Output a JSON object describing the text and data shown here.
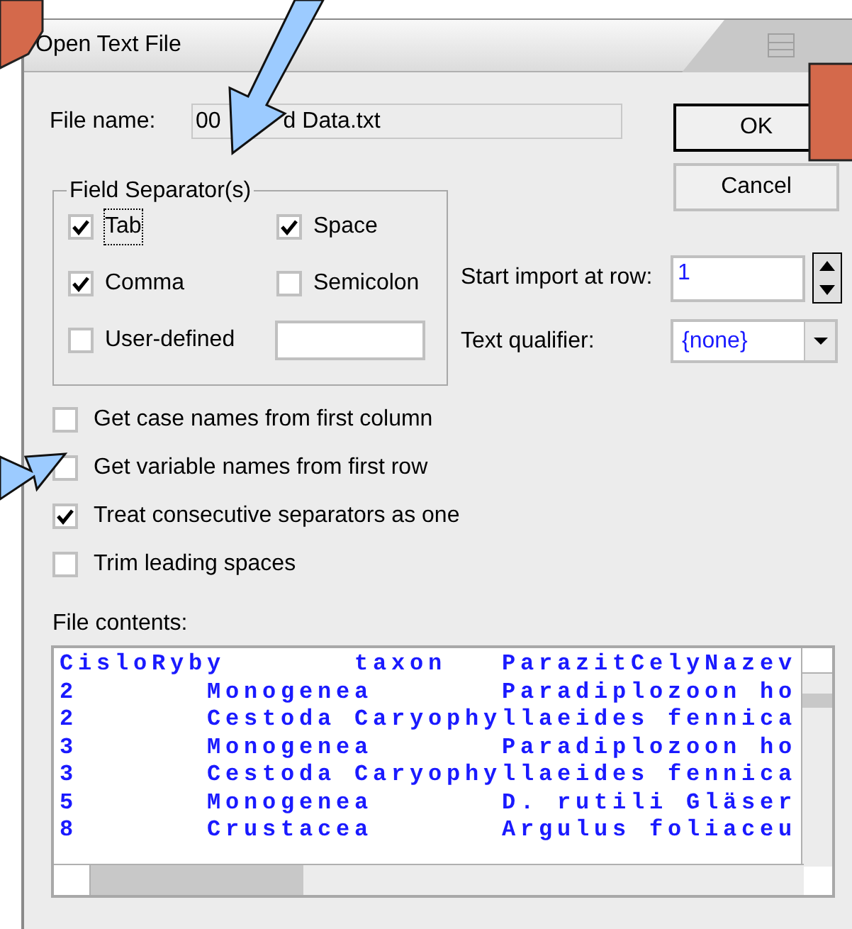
{
  "window": {
    "title": "Open Text File"
  },
  "file_name": {
    "label": "File name:",
    "value_parts": [
      "00",
      "d Data.txt"
    ]
  },
  "buttons": [
    {
      "label": "OK",
      "default": true
    },
    {
      "label": "Cancel",
      "default": false
    }
  ],
  "field_separators": {
    "title": "Field Separator(s)",
    "items": [
      {
        "kind": "checkbox",
        "label": "Tab",
        "checked": true,
        "focused": true
      },
      {
        "kind": "checkbox",
        "label": "Space",
        "checked": true,
        "focused": false
      },
      {
        "kind": "checkbox",
        "label": "Comma",
        "checked": true,
        "focused": false
      },
      {
        "kind": "checkbox",
        "label": "Semicolon",
        "checked": false,
        "focused": false
      },
      {
        "kind": "checkbox_with_field",
        "label": "User-defined",
        "checked": false,
        "focused": false
      }
    ]
  },
  "start_import_at_row": {
    "label": "Start import at row:",
    "value": "1"
  },
  "text_qualifier": {
    "label": "Text qualifier:",
    "value": "{none}"
  },
  "options": [
    {
      "label": "Get case names from first column",
      "checked": false
    },
    {
      "label": "Get variable names from first row",
      "checked": false
    },
    {
      "label": "Treat consecutive separators as one",
      "checked": true
    },
    {
      "label": "Trim leading spaces",
      "checked": false
    }
  ],
  "file_contents": {
    "label": "File contents:",
    "lines": [
      "CisloRyby       taxon   ParazitCelyNazev",
      "2       Monogenea       Paradiplozoon ho",
      "2       Cestoda Caryophyllaeides fennica",
      "3       Monogenea       Paradiplozoon ho",
      "3       Cestoda Caryophyllaeides fennica",
      "5       Monogenea       D. rutili Gläser",
      "8       Crustacea       Argulus foliaceu"
    ]
  }
}
